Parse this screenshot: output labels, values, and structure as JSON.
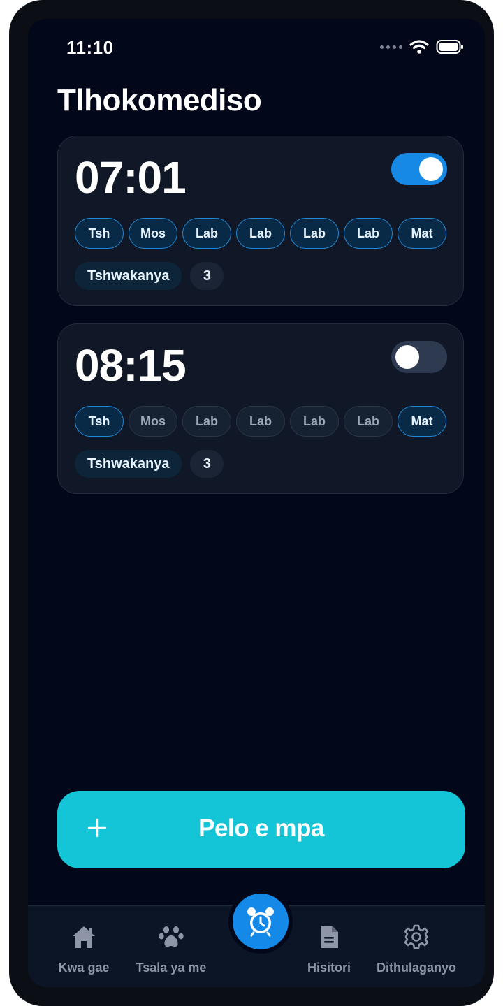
{
  "status": {
    "time": "11:10"
  },
  "page": {
    "title": "Tlhokomediso"
  },
  "alarms": [
    {
      "time": "07:01",
      "enabled": true,
      "days": [
        "Tsh",
        "Mos",
        "Lab",
        "Lab",
        "Lab",
        "Lab",
        "Mat"
      ],
      "days_active": [
        true,
        true,
        true,
        true,
        true,
        true,
        true
      ],
      "sound": "Tshwakanya",
      "count": "3"
    },
    {
      "time": "08:15",
      "enabled": false,
      "days": [
        "Tsh",
        "Mos",
        "Lab",
        "Lab",
        "Lab",
        "Lab",
        "Mat"
      ],
      "days_active": [
        true,
        false,
        false,
        false,
        false,
        false,
        true
      ],
      "sound": "Tshwakanya",
      "count": "3"
    }
  ],
  "add_button": {
    "label": "Pelo e mpa",
    "icon": "plus-icon"
  },
  "tabbar": {
    "items": [
      {
        "label": "Kwa gae",
        "icon": "home-icon"
      },
      {
        "label": "Tsala ya me",
        "icon": "paw-icon"
      },
      {
        "label": "",
        "icon": "alarm-clock-icon"
      },
      {
        "label": "Hisitori",
        "icon": "document-icon"
      },
      {
        "label": "Dithulaganyo",
        "icon": "gear-icon"
      }
    ]
  },
  "colors": {
    "accent": "#1689e6",
    "add_button": "#14c5d8",
    "background": "#02071a",
    "card": "#101827"
  }
}
